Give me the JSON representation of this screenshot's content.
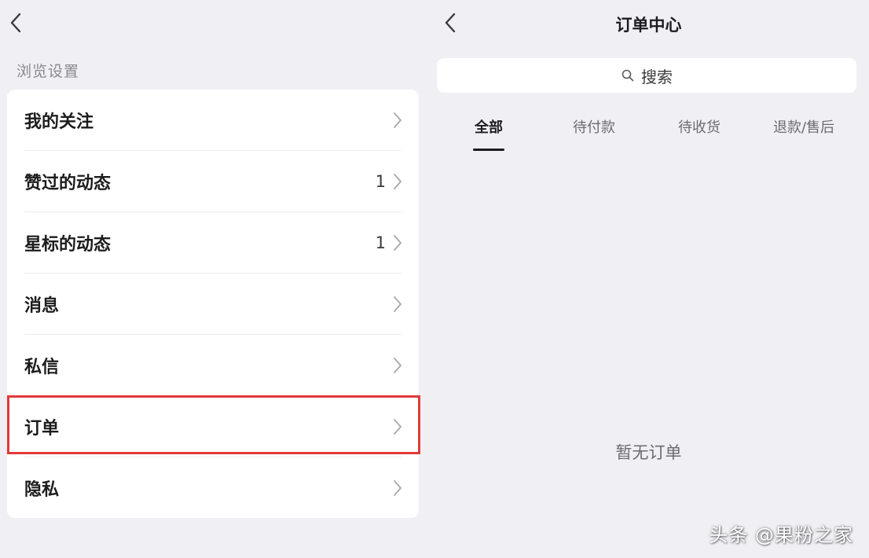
{
  "left_panel": {
    "section_title": "浏览设置",
    "menu_items": [
      {
        "label": "我的关注",
        "count": ""
      },
      {
        "label": "赞过的动态",
        "count": "1"
      },
      {
        "label": "星标的动态",
        "count": "1"
      },
      {
        "label": "消息",
        "count": ""
      },
      {
        "label": "私信",
        "count": ""
      },
      {
        "label": "订单",
        "count": "",
        "highlighted": true
      },
      {
        "label": "隐私",
        "count": ""
      }
    ],
    "highlight_color": "#e03a3a"
  },
  "right_panel": {
    "title": "订单中心",
    "search": {
      "placeholder": "搜索"
    },
    "tabs": [
      {
        "label": "全部",
        "active": true
      },
      {
        "label": "待付款",
        "active": false
      },
      {
        "label": "待收货",
        "active": false
      },
      {
        "label": "退款/售后",
        "active": false
      }
    ],
    "empty_message": "暂无订单"
  },
  "watermark": "头条 @果粉之家",
  "icons": {
    "back": "chevron-left-icon",
    "row_arrow": "chevron-right-icon",
    "search": "search-icon"
  },
  "colors": {
    "background": "#f0eff4",
    "card": "#ffffff",
    "text_primary": "#1c1c1e",
    "text_secondary": "#8a8a8e"
  }
}
